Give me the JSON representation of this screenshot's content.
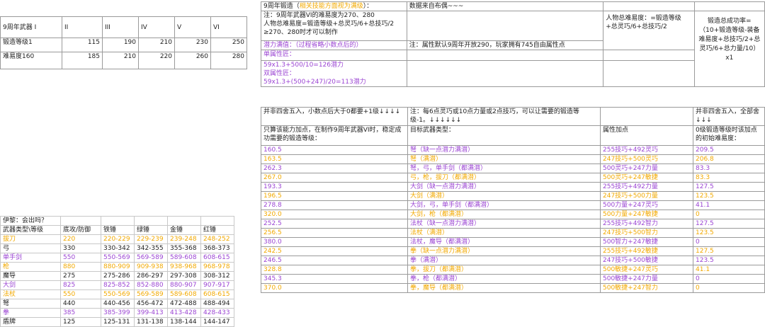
{
  "colors": {
    "purple": "#9b45d3",
    "orange": "#f2a900",
    "grid": "#9a9a9a"
  },
  "top_left": {
    "header": [
      "9周年武器 I",
      "II",
      "III",
      "IV",
      "V",
      "VI"
    ],
    "rows": [
      [
        "锻造等级1",
        "115",
        "190",
        "210",
        "230",
        "250"
      ],
      [
        "难易度160",
        "185",
        "210",
        "220",
        "260",
        "280"
      ]
    ]
  },
  "top_mid": {
    "title_a": "9周年锻造（",
    "title_b": "相关技能方面视为满级",
    "title_c": "）：",
    "source": "数据来自布偶~~~",
    "note_lines": [
      "注：9周年武器VI的难易度为270、280",
      "人物总难易度=锻造等级+总灵巧/6+总技巧/2",
      "≥270、280时才可以制作"
    ],
    "full_line_a": "潜力满值：",
    "full_line_b": "（过程省略小数点后的）",
    "attr_note": "注：属性默认9周年开放290，玩家拥有745自由属性点",
    "single_label": "单属性匠：",
    "single_formula": "59x1.3+500/10=126潜力",
    "double_label": "双属性匠：",
    "double_formula": "59x1.3+(500+247)/20=113潜力",
    "char_difficulty": "人物总难易度：=锻造等级+总灵巧/6+总技巧/2",
    "success_rate": "锻造总成功率=（10+锻造等级-装备难易度+总技巧/2+总灵巧/6+总力量/10）x1"
  },
  "mid_headers": {
    "round_a": "并非四舍五入，小数点后大于0都要+1级↓↓↓↓",
    "note_b": "注：每6点灵巧或10点力量或2点技巧，可以让需要的锻造等级-1。↓↓↓↓↓↓",
    "round_c": "并非四舍五入，全部舍↓↓↓",
    "col1": "只算该能力加点，在制作9周年武器VI时，稳定成功需要的锻造等级：",
    "col2": "目标武器类型：",
    "col3": "属性加点",
    "col4": "0级锻造等级时该加点的初始难易度："
  },
  "main_rows": [
    {
      "level": "160.5",
      "weapon": "弩（缺一点潜力满潜）",
      "attr": "255技巧+492灵巧",
      "init": "209.5",
      "color": "purple"
    },
    {
      "level": "163.5",
      "weapon": "弩（满潜）",
      "attr": "247技巧+500灵巧",
      "init": "206.8",
      "color": "orange"
    },
    {
      "level": "262.3",
      "weapon": "弩，弓，单手剑（都满潜）",
      "attr": "500灵巧+247力量",
      "init": "83.3",
      "color": "purple"
    },
    {
      "level": "267.0",
      "weapon": "弓，枪，拔刀（都满潜）",
      "attr": "500灵巧+247敏捷",
      "init": "83.3",
      "color": "orange"
    },
    {
      "level": "193.3",
      "weapon": "大剑（缺一点潜力满潜）",
      "attr": "255技巧+492力量",
      "init": "127.5",
      "color": "purple"
    },
    {
      "level": "196.5",
      "weapon": "大剑（满潜）",
      "attr": "247技巧+500力量",
      "init": "123.5",
      "color": "orange"
    },
    {
      "level": "278.8",
      "weapon": "大剑，弓，单手剑（都满潜）",
      "attr": "500力量+247灵巧",
      "init": "41.1",
      "color": "purple"
    },
    {
      "level": "320.0",
      "weapon": "大剑，枪（都满潜）",
      "attr": "500力量+247敏捷",
      "init": "0",
      "color": "orange"
    },
    {
      "level": "252.5",
      "weapon": "法杖（缺一点潜力满潜）",
      "attr": "255技巧+492智力",
      "init": "127.5",
      "color": "purple"
    },
    {
      "level": "256.5",
      "weapon": "法杖（满潜）",
      "attr": "247技巧+500智力",
      "init": "123.5",
      "color": "orange"
    },
    {
      "level": "380.0",
      "weapon": "法杖，魔导（都满潜）",
      "attr": "500智力+247敏捷",
      "init": "0",
      "color": "purple"
    },
    {
      "level": "242.5",
      "weapon": "拳（缺一点潜力满潜）",
      "attr": "255技巧+492敏捷",
      "init": "127.5",
      "color": "orange"
    },
    {
      "level": "246.5",
      "weapon": "拳（满潜）",
      "attr": "247技巧+500敏捷",
      "init": "123.5",
      "color": "purple"
    },
    {
      "level": "328.8",
      "weapon": "拳，拔刀（都满潜）",
      "attr": "500敏捷+247灵巧",
      "init": "41.1",
      "color": "orange"
    },
    {
      "level": "345.3",
      "weapon": "拳，枪（都满潜）",
      "attr": "500敏捷+247力量",
      "init": "0",
      "color": "purple"
    },
    {
      "level": "370.0",
      "weapon": "拳，魔导（都满潜）",
      "attr": "500敏捷+247智力",
      "init": "0",
      "color": "orange"
    }
  ],
  "left_table": {
    "caption": "伊黎：会出吗？",
    "header": [
      "武器类型\\等级",
      "底攻/防御",
      "铁锤",
      "绿锤",
      "金锤",
      "红锤"
    ],
    "rows": [
      {
        "cells": [
          "拔刀",
          "220",
          "220-229",
          "229-239",
          "239-248",
          "248-252"
        ],
        "color": "orange"
      },
      {
        "cells": [
          "弓",
          "330",
          "330-342",
          "342-355",
          "355-368",
          "368-373"
        ],
        "color": ""
      },
      {
        "cells": [
          "单手剑",
          "550",
          "550-569",
          "569-589",
          "589-608",
          "608-615"
        ],
        "color": "purple"
      },
      {
        "cells": [
          "枪",
          "880",
          "880-909",
          "909-938",
          "938-968",
          "968-978"
        ],
        "color": "orange"
      },
      {
        "cells": [
          "魔导",
          "275",
          "275-286",
          "286-297",
          "297-308",
          "308-312"
        ],
        "color": ""
      },
      {
        "cells": [
          "大剑",
          "825",
          "825-852",
          "852-880",
          "880-907",
          "907-917"
        ],
        "color": "purple"
      },
      {
        "cells": [
          "法杖",
          "550",
          "550-569",
          "569-589",
          "589-608",
          "608-615"
        ],
        "color": "orange"
      },
      {
        "cells": [
          "弩",
          "440",
          "440-456",
          "456-472",
          "472-488",
          "488-494"
        ],
        "color": ""
      },
      {
        "cells": [
          "拳",
          "385",
          "385-399",
          "399-413",
          "413-428",
          "428-433"
        ],
        "color": "purple"
      },
      {
        "cells": [
          "盾牌",
          "125",
          "125-131",
          "131-138",
          "138-144",
          "144-147"
        ],
        "color": ""
      }
    ]
  }
}
